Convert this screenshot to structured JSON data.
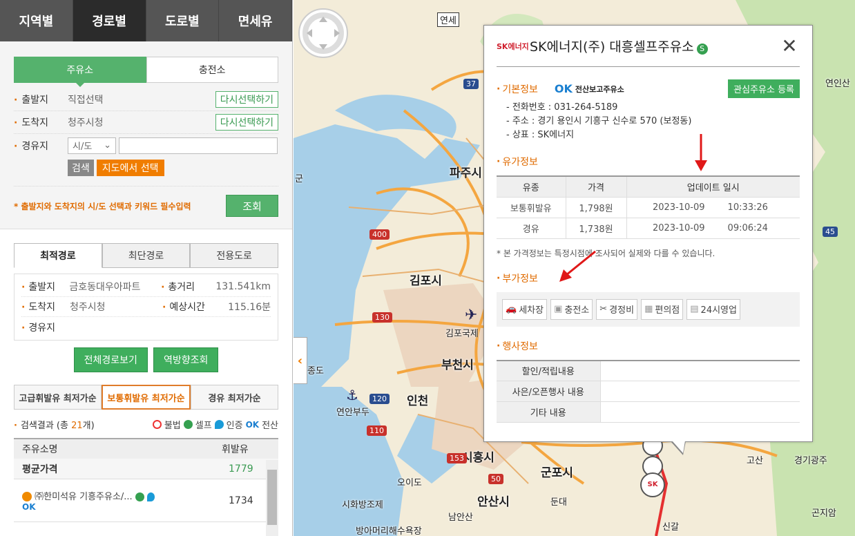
{
  "top_tabs": [
    "지역별",
    "경로별",
    "도로별",
    "면세유"
  ],
  "search": {
    "type_tabs": [
      "주유소",
      "충전소"
    ],
    "origin_label": "출발지",
    "origin_value": "직접선택",
    "origin_btn": "다시선택하기",
    "dest_label": "도착지",
    "dest_value": "청주시청",
    "dest_btn": "다시선택하기",
    "via_label": "경유지",
    "via_select": "시/도",
    "search_btn": "검색",
    "map_select_btn": "지도에서 선택",
    "notice": "* 출발지와 도착지의 시/도 선택과 키워드 필수입력",
    "query_btn": "조회"
  },
  "route_tabs": [
    "최적경로",
    "최단경로",
    "전용도로"
  ],
  "route_info": {
    "origin_label": "출발지",
    "origin_value": "금호동대우아파트",
    "distance_label": "총거리",
    "distance_value": "131.541km",
    "dest_label": "도착지",
    "dest_value": "청주시청",
    "time_label": "예상시간",
    "time_value": "115.16분",
    "via_label": "경유지"
  },
  "route_buttons": [
    "전체경로보기",
    "역방향조회"
  ],
  "fuel_tabs": [
    "고급휘발유 최저가순",
    "보통휘발유 최저가순",
    "경유 최저가순"
  ],
  "results": {
    "prefix": "검색결과 (총 ",
    "count": "21",
    "suffix": "개)",
    "legend": [
      "불법",
      "셀프",
      "인증",
      "전산"
    ],
    "col_name": "주유소명",
    "col_price": "휘발유",
    "avg_label": "평균가격",
    "avg_value": "1779",
    "row1_name": "㈜한미석유 기흥주유소/...",
    "row1_price": "1734"
  },
  "map_labels": [
    "연세",
    "파주시",
    "김포시",
    "김포국제",
    "부천시",
    "인천",
    "연안부두",
    "시흥시",
    "군포시",
    "안산시",
    "오이도",
    "시화방조제",
    "연인산",
    "종도",
    "군",
    "경기광주",
    "고산",
    "곤지암",
    "신갈",
    "남안산",
    "둔대",
    "방아머리해수욕장"
  ],
  "highway_shields": [
    "37",
    "400",
    "130",
    "120",
    "110",
    "153",
    "50",
    "45"
  ],
  "popup": {
    "brand": "SK에너지",
    "title": "SK에너지(주) 대흥셀프주유소",
    "self_mark": "S",
    "basic_title": "기본정보",
    "ok_logo_text": "전산보고주유소",
    "fav_btn": "관심주유소 등록",
    "phone": "- 전화번호 : 031-264-5189",
    "address": "- 주소 : 경기 용인시 기흥구 신수로 570 (보정동)",
    "brand_line": "- 상표 : SK에너지",
    "price_title": "유가정보",
    "price_headers": [
      "유종",
      "가격",
      "업데이트 일시"
    ],
    "prices": [
      {
        "type": "보통휘발유",
        "price": "1,798원",
        "date": "2023-10-09",
        "time": "10:33:26"
      },
      {
        "type": "경유",
        "price": "1,738원",
        "date": "2023-10-09",
        "time": "09:06:24"
      }
    ],
    "note": "* 본 가격정보는 특정시점에 조사되어 실제와 다를 수 있습니다.",
    "extra_title": "부가정보",
    "extras": [
      "세차장",
      "충전소",
      "경정비",
      "편의점",
      "24시영업"
    ],
    "event_title": "행사정보",
    "events": [
      "할인/적립내용",
      "사은/오픈행사 내용",
      "기타 내용"
    ]
  },
  "colors": {
    "green": "#55b26d",
    "orange": "#e06b00",
    "red": "#d0202e"
  }
}
